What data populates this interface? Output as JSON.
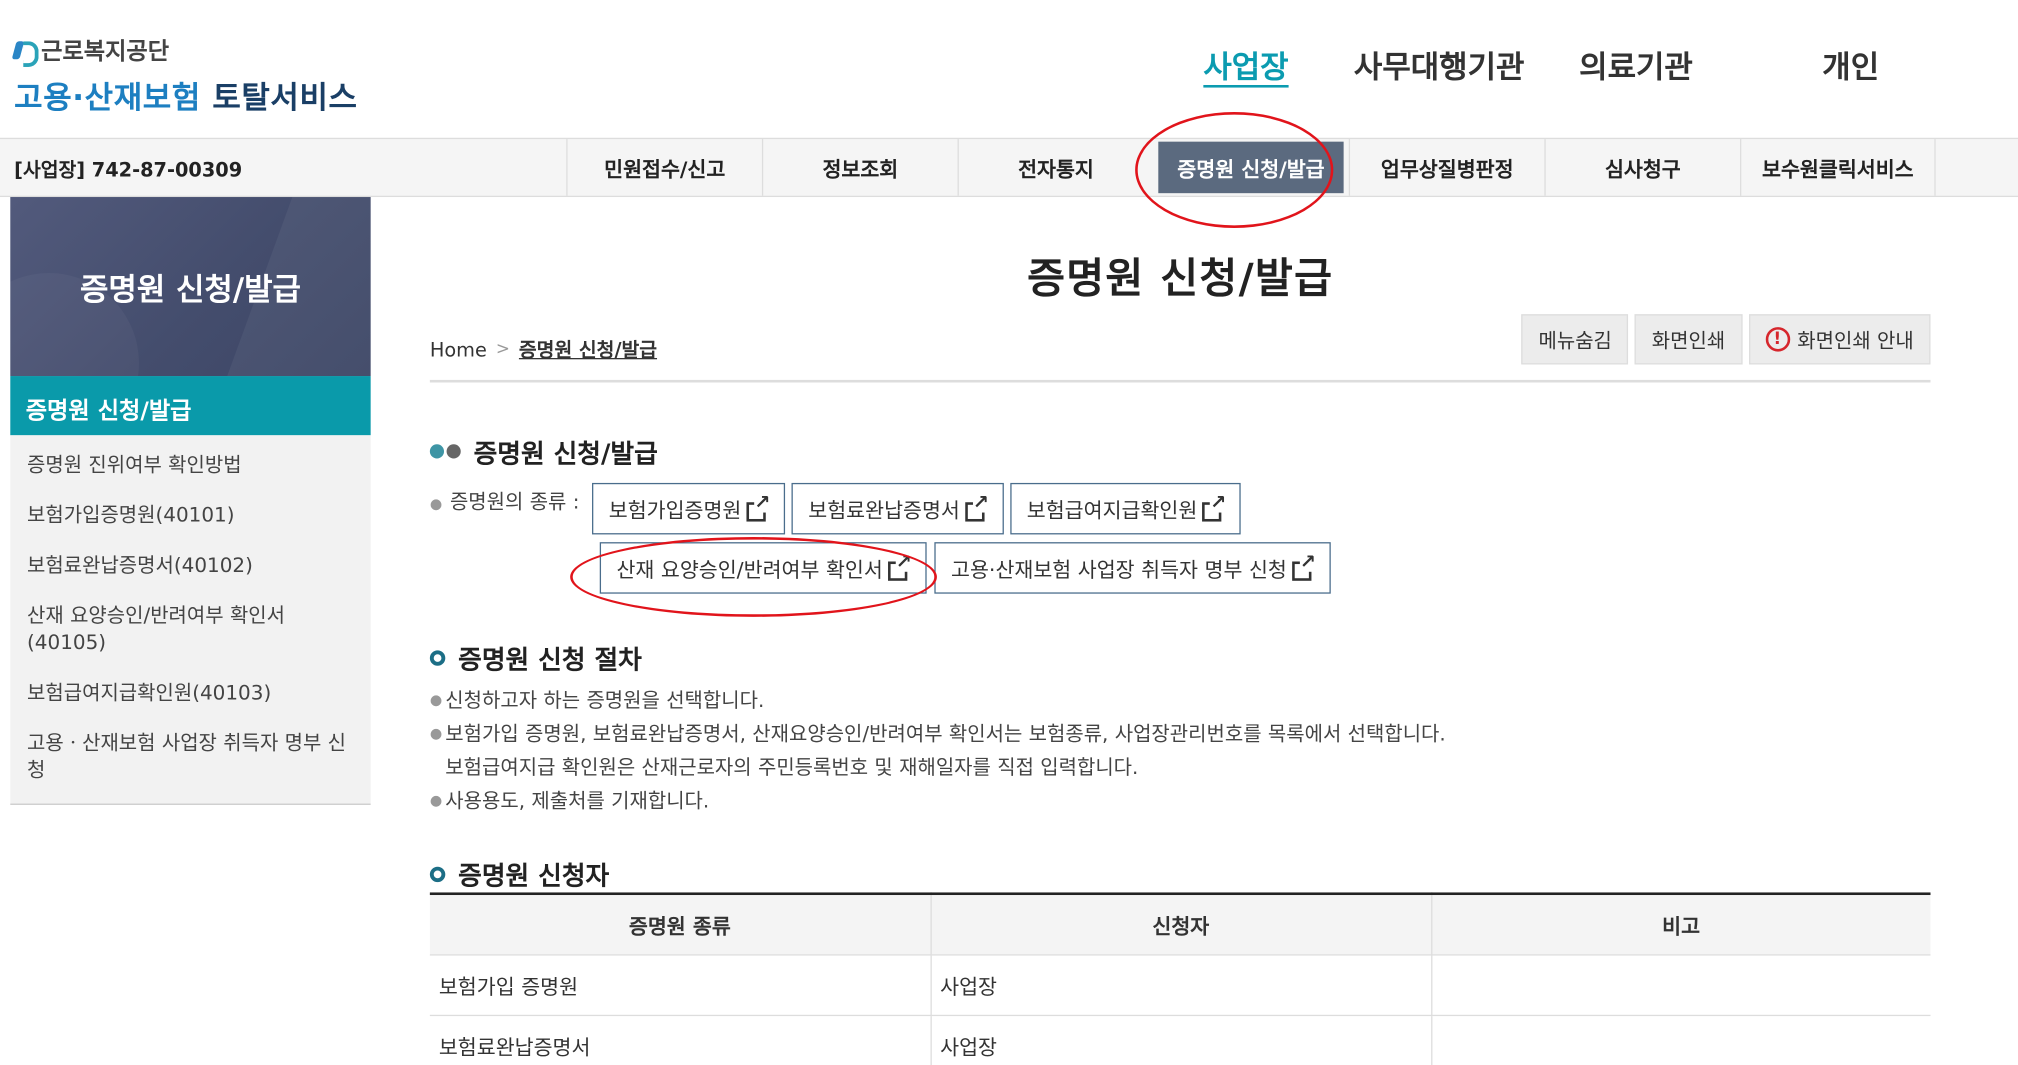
{
  "header": {
    "org_name": "근로복지공단",
    "title_part1": "고용·산재보험",
    "title_part2": "토탈서비스",
    "top_nav": [
      "사업장",
      "사무대행기관",
      "의료기관",
      "개인"
    ]
  },
  "bar": {
    "business_id": "[사업장] 742-87-00309",
    "menu": [
      "민원접수/신고",
      "정보조회",
      "전자통지",
      "증명원 신청/발급",
      "업무상질병판정",
      "심사청구",
      "보수원클릭서비스"
    ]
  },
  "sidebar": {
    "heading": "증명원 신청/발급",
    "active": "증명원 신청/발급",
    "items": [
      "증명원 진위여부 확인방법",
      "보험가입증명원(40101)",
      "보험료완납증명서(40102)",
      "산재 요양승인/반려여부 확인서 (40105)",
      "보험급여지급확인원(40103)",
      "고용ㆍ산재보험 사업장 취득자 명부 신청"
    ]
  },
  "main": {
    "page_title": "증명원 신청/발급",
    "breadcrumb": {
      "home": "Home",
      "sep": ">",
      "current": "증명원 신청/발급"
    },
    "tools": {
      "hide_menu": "메뉴숨김",
      "print": "화면인쇄",
      "print_guide": "화면인쇄 안내",
      "alert_glyph": "!"
    },
    "section1": {
      "title": "증명원 신청/발급",
      "label": "증명원의 종류 :",
      "row1": [
        "보험가입증명원",
        "보험료완납증명서",
        "보험급여지급확인원"
      ],
      "row2": [
        "산재 요양승인/반려여부 확인서",
        "고용·산재보험 사업장 취득자 명부 신청"
      ]
    },
    "section2": {
      "title": "증명원 신청 절차",
      "lines": [
        "신청하고자 하는 증명원을 선택합니다.",
        "보험가입 증명원, 보험료완납증명서, 산재요양승인/반려여부 확인서는 보험종류, 사업장관리번호를 목록에서 선택합니다.",
        "보험급여지급 확인원은 산재근로자의 주민등록번호 및 재해일자를 직접 입력합니다.",
        "사용용도, 제출처를 기재합니다."
      ]
    },
    "section3": {
      "title": "증명원 신청자",
      "headers": [
        "증명원 종류",
        "신청자",
        "비고"
      ],
      "rows": [
        [
          "보험가입 증명원",
          "사업장",
          ""
        ],
        [
          "보험료완납증명서",
          "사업장",
          ""
        ]
      ]
    }
  },
  "colors": {
    "accent_teal": "#0a9aaa",
    "active_menu_bg": "#5b6a7f",
    "sidebar_head_bg": "#4a5274",
    "annotation_red": "#e1141b"
  },
  "icons": [
    "logo-mark-icon",
    "external-link-icon",
    "alert-circle-icon",
    "bullet-dot-icon",
    "ring-bullet-icon"
  ]
}
